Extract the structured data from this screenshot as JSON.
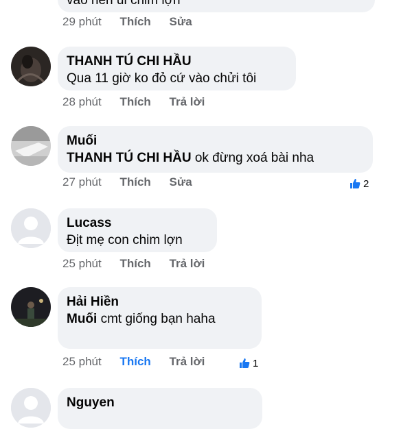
{
  "comments": [
    {
      "text": "vào nên ủi chim lợn",
      "time": "29 phút",
      "like_label": "Thích",
      "action_label": "Sửa"
    },
    {
      "author": "THANH TÚ CHI HẦU",
      "text": "Qua 11 giờ ko đỏ cứ vào chửi tôi",
      "time": "28 phút",
      "like_label": "Thích",
      "action_label": "Trả lời"
    },
    {
      "author": "Muối",
      "mention": "THANH TÚ CHI HẦU",
      "text": "ok đừng xoá bài nha",
      "time": "27 phút",
      "like_label": "Thích",
      "action_label": "Sửa",
      "reaction_count": "2"
    },
    {
      "author": "Lucass",
      "text": "Địt mẹ con chim lợn",
      "time": "25 phút",
      "like_label": "Thích",
      "action_label": "Trả lời"
    },
    {
      "author": "Hải Hiền",
      "mention": "Muối",
      "text": "cmt giống bạn haha",
      "time": "25 phút",
      "like_label": "Thích",
      "action_label": "Trả lời",
      "reaction_count": "1",
      "liked": true
    },
    {
      "author": "Nguyen"
    }
  ],
  "colors": {
    "bubble": "#f0f2f5",
    "meta": "#65676b",
    "like_active": "#1877f2"
  }
}
